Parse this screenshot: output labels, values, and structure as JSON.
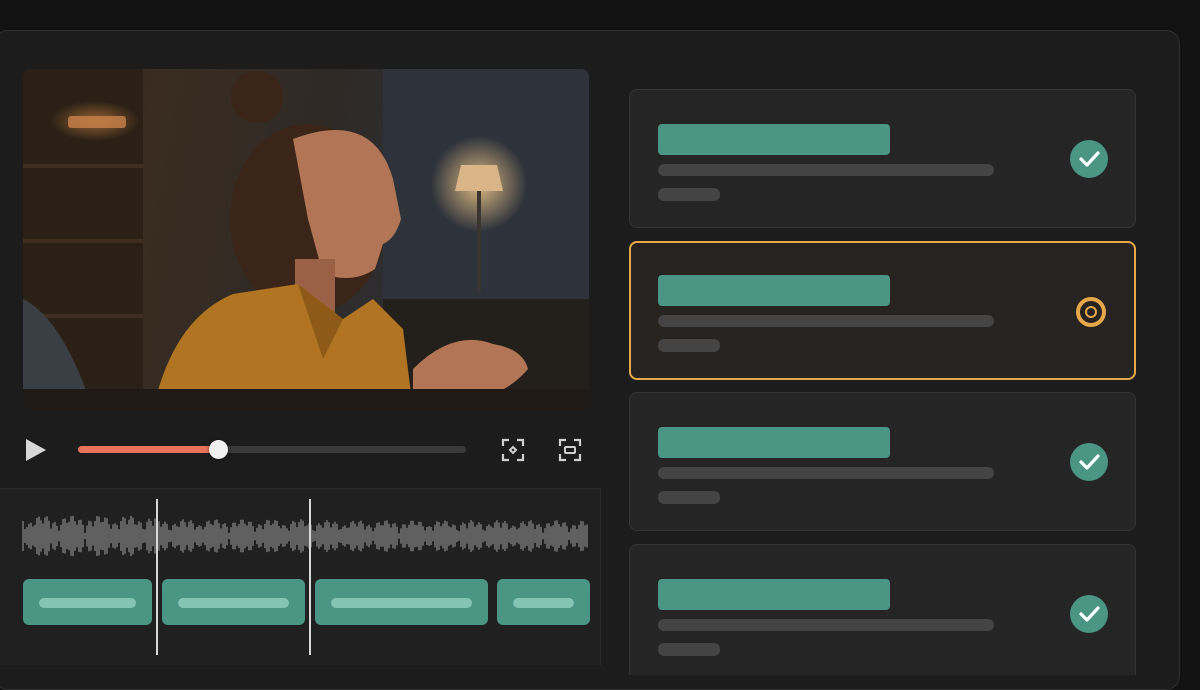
{
  "colors": {
    "accent_teal": "#4a9584",
    "accent_amber": "#e6a84a",
    "progress_red": "#e8735a",
    "background": "#1c1c1c"
  },
  "player": {
    "play_icon": "play-icon",
    "progress": 0.36,
    "icons": [
      "focus-frame-icon",
      "caption-frame-icon"
    ]
  },
  "timeline": {
    "playhead_count": 2,
    "clip_count": 4
  },
  "tasks": [
    {
      "status": "done",
      "icon": "check-icon"
    },
    {
      "status": "in-progress",
      "icon": "in-progress-icon"
    },
    {
      "status": "done",
      "icon": "check-icon"
    },
    {
      "status": "done",
      "icon": "check-icon"
    }
  ]
}
